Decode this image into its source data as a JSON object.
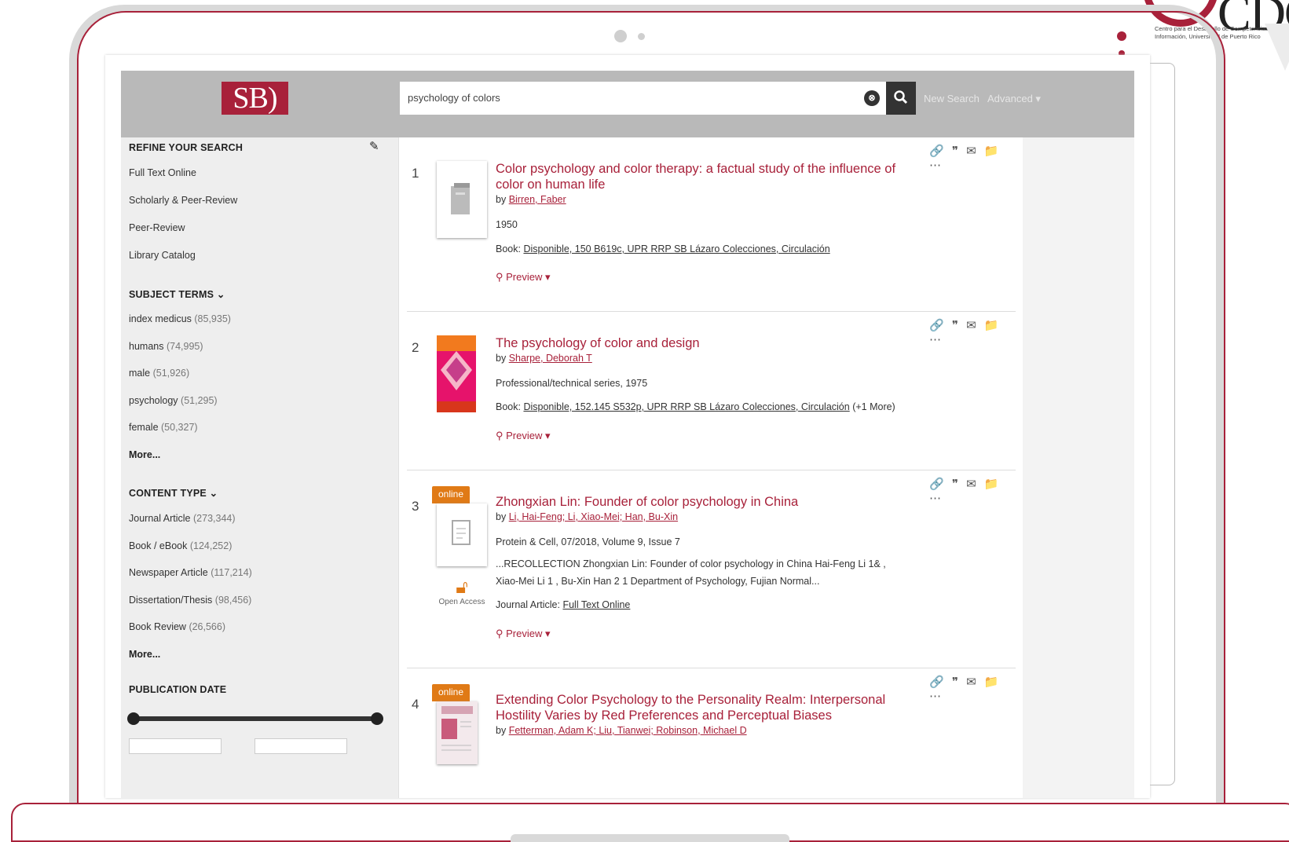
{
  "app": {
    "logo_text": "SB)",
    "corner_logo_text": "CDC",
    "corner_logo_caption": "Centro para el Desarrollo de Competencias de Información, Universidad de Puerto Rico"
  },
  "header": {
    "search_value": "psychology of colors",
    "clear_icon": "⊗",
    "search_icon": "🔍",
    "new_search": "New Search",
    "advanced": "Advanced ▾"
  },
  "sidebar": {
    "refine_title": "REFINE YOUR SEARCH",
    "refine_items": [
      "Full Text Online",
      "Scholarly & Peer-Review",
      "Peer-Review",
      "Library Catalog"
    ],
    "subject_title": "SUBJECT TERMS ⌄",
    "subjects": [
      {
        "label": "index medicus",
        "count": "(85,935)"
      },
      {
        "label": "humans",
        "count": "(74,995)"
      },
      {
        "label": "male",
        "count": "(51,926)"
      },
      {
        "label": "psychology",
        "count": "(51,295)"
      },
      {
        "label": "female",
        "count": "(50,327)"
      }
    ],
    "more": "More...",
    "content_title": "CONTENT TYPE ⌄",
    "content_types": [
      {
        "label": "Journal Article",
        "count": "(273,344)"
      },
      {
        "label": "Book / eBook",
        "count": "(124,252)"
      },
      {
        "label": "Newspaper Article",
        "count": "(117,214)"
      },
      {
        "label": "Dissertation/Thesis",
        "count": "(98,456)"
      },
      {
        "label": "Book Review",
        "count": "(26,566)"
      }
    ],
    "more2": "More...",
    "pubdate_title": "PUBLICATION DATE"
  },
  "results": [
    {
      "num": "1",
      "title": "Color psychology and color therapy: a factual study of the influence of color on human life",
      "by_prefix": "by ",
      "authors": "Birren, Faber",
      "line1": "1950",
      "line2_prefix": "Book: ",
      "line2_link": "Disponible, 150 B619c, UPR RRP SB Lázaro Colecciones, Circulación",
      "preview": "Preview ▾",
      "tools": "🔗 ❞ ✉ 📁 ⋯"
    },
    {
      "num": "2",
      "title": "The psychology of color and design",
      "by_prefix": "by ",
      "authors": "Sharpe, Deborah T",
      "line1": "Professional/technical series, 1975",
      "line2_prefix": "Book: ",
      "line2_link": "Disponible, 152.145 S532p, UPR RRP SB Lázaro Colecciones, Circulación",
      "line2_suffix": " (+1 More)",
      "preview": "Preview ▾",
      "tools": "🔗 ❞ ✉ 📁 ⋯"
    },
    {
      "num": "3",
      "online": "online",
      "title": "Zhongxian Lin: Founder of color psychology in China",
      "by_prefix": "by ",
      "authors": "Li, Hai-Feng; Li, Xiao-Mei; Han, Bu-Xin",
      "line1": "Protein & Cell, 07/2018, Volume 9, Issue 7",
      "snippet": "...RECOLLECTION Zhongxian Lin: Founder of color psychology in China Hai-Feng Li 1& , Xiao-Mei Li 1 , Bu-Xin Han 2 1 Department of Psychology, Fujian Normal...",
      "line2_prefix": "Journal Article: ",
      "line2_link": "Full Text Online",
      "open_access": "Open Access",
      "preview": "Preview ▾",
      "tools": "🔗 ❞ ✉ 📁 ⋯"
    },
    {
      "num": "4",
      "online": "online",
      "title": "Extending Color Psychology to the Personality Realm: Interpersonal Hostility Varies by Red Preferences and Perceptual Biases",
      "by_prefix": "by ",
      "authors": "Fetterman, Adam K; Liu, Tianwei; Robinson, Michael D",
      "tools": "🔗 ❞ ✉ 📁 ⋯"
    }
  ]
}
